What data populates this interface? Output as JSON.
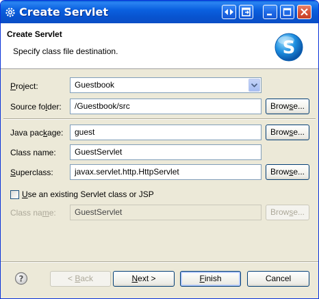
{
  "window": {
    "title": "Create Servlet",
    "icon": "gear-icon"
  },
  "title_buttons": [
    "swap-icon",
    "restore-window-icon",
    "minimize-icon",
    "maximize-icon",
    "close-icon"
  ],
  "header": {
    "title": "Create Servlet",
    "description": "Specify class file destination.",
    "logo_letter": "S"
  },
  "form": {
    "project": {
      "label_pre": "",
      "label_key": "P",
      "label_post": "roject:",
      "value": "Guestbook"
    },
    "source_folder": {
      "label_pre": "Source fo",
      "label_key": "l",
      "label_post": "der:",
      "value": "/Guestbook/src"
    },
    "java_package": {
      "label_pre": "Java pac",
      "label_key": "k",
      "label_post": "age:",
      "value": "guest"
    },
    "class_name": {
      "label": "Class name:",
      "value": "GuestServlet"
    },
    "superclass": {
      "label_pre": "",
      "label_key": "S",
      "label_post": "uperclass:",
      "value": "javax.servlet.http.HttpServlet"
    },
    "use_existing": {
      "label_pre": "",
      "label_key": "U",
      "label_post": "se an existing Servlet class or JSP",
      "checked": false
    },
    "existing_class_name": {
      "label_pre": "Class na",
      "label_key": "m",
      "label_post": "e:",
      "value": "GuestServlet"
    }
  },
  "browse": {
    "pre": "Brow",
    "key": "s",
    "post": "e..."
  },
  "buttons": {
    "back": {
      "pre": "< ",
      "key": "B",
      "post": "ack"
    },
    "next": {
      "pre": "",
      "key": "N",
      "post": "ext >"
    },
    "finish": {
      "pre": "",
      "key": "F",
      "post": "inish"
    },
    "cancel": "Cancel"
  },
  "colors": {
    "titlebar": "#0a5fd8",
    "dialog_bg": "#ece9d8",
    "header_bg": "#ffffff",
    "logo": "#1e8fe0"
  }
}
